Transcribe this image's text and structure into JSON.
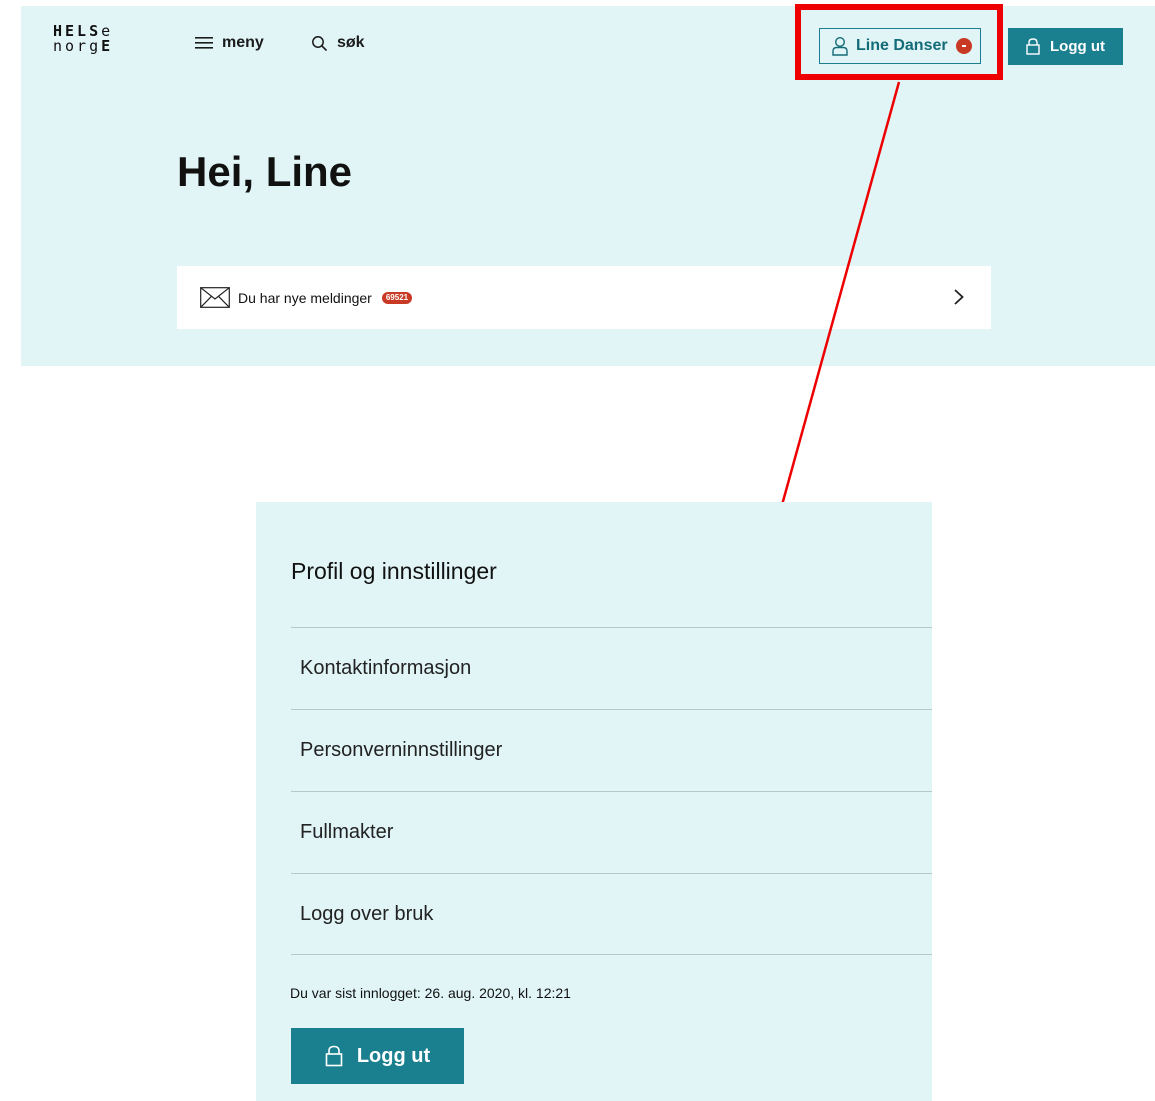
{
  "logo": {
    "line1": "HELSe",
    "line2": "norgE"
  },
  "header": {
    "menu_label": "meny",
    "search_label": "søk",
    "user_name": "Line Danser",
    "logout_label": "Logg ut"
  },
  "icons": {
    "menu": "hamburger-icon",
    "search": "search-icon",
    "user": "person-icon",
    "logout": "lock-icon",
    "messages": "envelope-icon",
    "chevron": "chevron-right-icon"
  },
  "main": {
    "greeting": "Hei, Line",
    "messages_text": "Du har nye meldinger",
    "messages_count": "69521"
  },
  "profile_menu": {
    "title": "Profil og innstillinger",
    "items": [
      {
        "label": "Kontaktinformasjon"
      },
      {
        "label": "Personverninnstillinger"
      },
      {
        "label": "Fullmakter"
      },
      {
        "label": "Logg over bruk"
      }
    ],
    "last_login": "Du var sist innlogget: 26. aug. 2020, kl. 12:21",
    "logout_label": "Logg ut"
  },
  "colors": {
    "panel_bg": "#e1f5f7",
    "accent": "#1a7f8e",
    "badge": "#c93a25",
    "annotation": "#ee0000"
  }
}
